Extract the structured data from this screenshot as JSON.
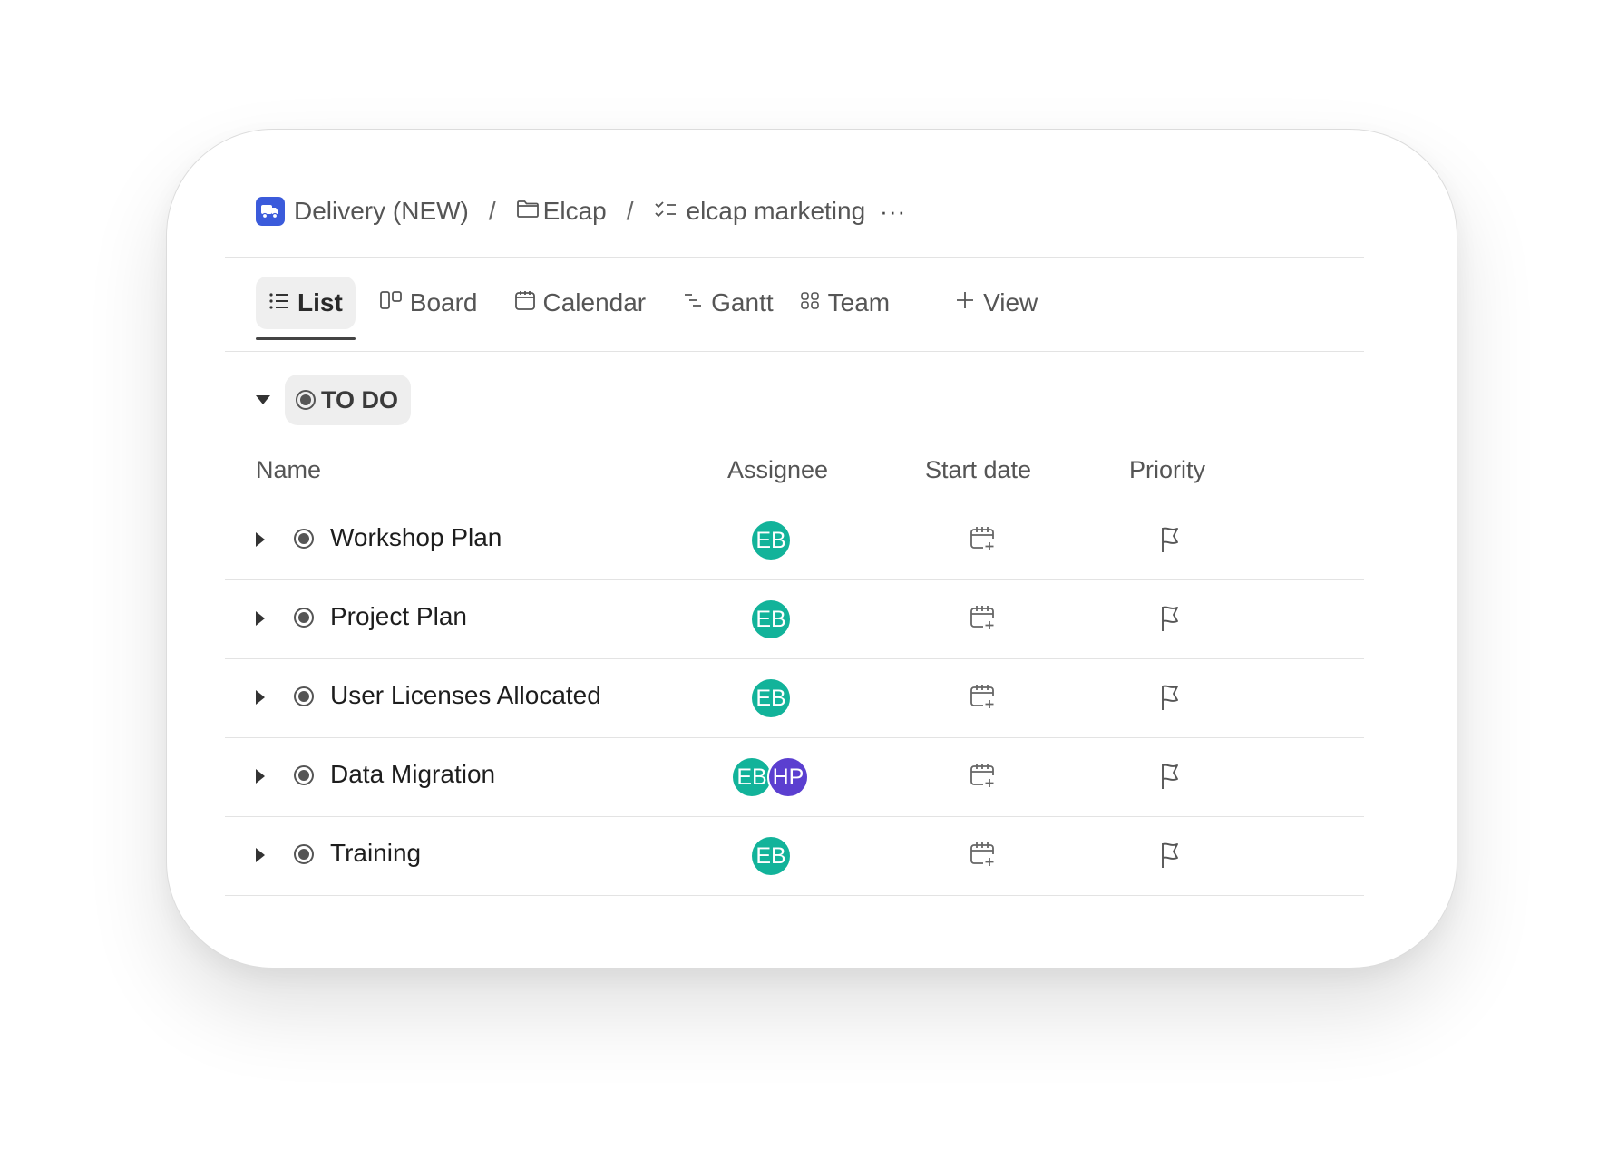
{
  "breadcrumb": {
    "space": "Delivery (NEW)",
    "folder": "Elcap",
    "list": "elcap marketing",
    "separator": "/",
    "more": "···"
  },
  "tabs": [
    {
      "label": "List",
      "icon": "list-icon",
      "active": true
    },
    {
      "label": "Board",
      "icon": "board-icon",
      "active": false
    },
    {
      "label": "Calendar",
      "icon": "calendar-icon",
      "active": false
    },
    {
      "label": "Gantt",
      "icon": "gantt-icon",
      "active": false
    },
    {
      "label": "Team",
      "icon": "team-icon",
      "active": false
    }
  ],
  "add_view_label": "View",
  "group": {
    "status": "TO DO"
  },
  "columns": {
    "name": "Name",
    "assignee": "Assignee",
    "start_date": "Start date",
    "priority": "Priority"
  },
  "tasks": [
    {
      "name": "Workshop Plan",
      "assignees": [
        {
          "initials": "EB",
          "color": "#12b39a"
        }
      ]
    },
    {
      "name": "Project Plan",
      "assignees": [
        {
          "initials": "EB",
          "color": "#12b39a"
        }
      ]
    },
    {
      "name": "User Licenses Allocated",
      "assignees": [
        {
          "initials": "EB",
          "color": "#12b39a"
        }
      ]
    },
    {
      "name": "Data Migration",
      "assignees": [
        {
          "initials": "EB",
          "color": "#12b39a"
        },
        {
          "initials": "HP",
          "color": "#5b3fd0"
        }
      ]
    },
    {
      "name": "Training",
      "assignees": [
        {
          "initials": "EB",
          "color": "#12b39a"
        }
      ]
    }
  ],
  "colors": {
    "app_logo": "#3b5bdb",
    "avatar_eb": "#12b39a",
    "avatar_hp": "#5b3fd0"
  }
}
